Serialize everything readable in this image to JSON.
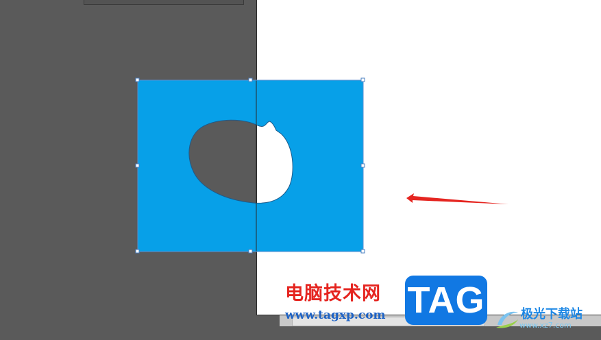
{
  "watermark": {
    "title": "电脑技术网",
    "url": "www.tagxp.com",
    "logo": "TAG",
    "brand": "极光下载站",
    "brand_url": "www.xz7.com"
  },
  "colors": {
    "pasteboard": "#5a5a5a",
    "artboard": "#ffffff",
    "shape_fill": "#07a0e8",
    "arrow": "#e52520",
    "logo_bg": "#1178e3"
  },
  "icons": {
    "annotation": "red-arrow-icon",
    "brand": "aurora-swoosh-icon"
  }
}
